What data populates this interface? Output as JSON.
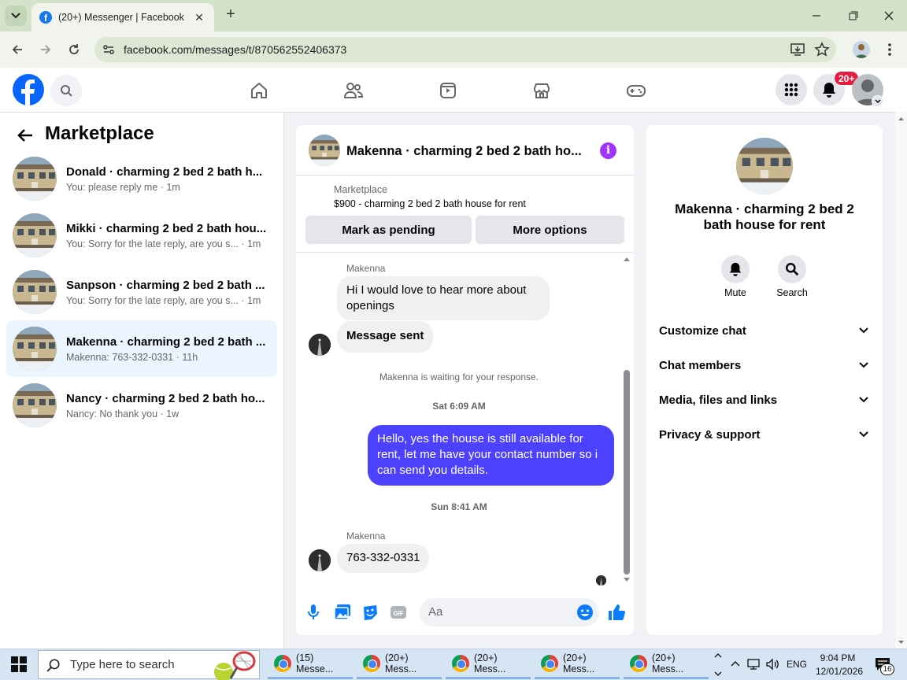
{
  "browser": {
    "tab_title": "(20+) Messenger | Facebook",
    "url": "facebook.com/messages/t/870562552406373",
    "new_tab": "+",
    "close_tab": "✕"
  },
  "fb": {
    "notif_badge": "20+"
  },
  "left": {
    "title": "Marketplace",
    "conversations": [
      {
        "name": "Donald · charming 2 bed 2 bath h...",
        "preview": "You: please reply me · 1m",
        "active": false
      },
      {
        "name": "Mikki · charming 2 bed 2 bath hou...",
        "preview": "You: Sorry for the late reply, are you s... · 1m",
        "active": false
      },
      {
        "name": "Sanpson · charming 2 bed 2 bath ...",
        "preview": "You: Sorry for the late reply, are you s... · 1m",
        "active": false
      },
      {
        "name": "Makenna · charming 2 bed 2 bath ...",
        "preview": "Makenna: 763-332-0331 · 11h",
        "active": true
      },
      {
        "name": "Nancy · charming 2 bed 2 bath ho...",
        "preview": "Nancy: No thank you · 1w",
        "active": false
      }
    ]
  },
  "chat": {
    "title": "Makenna · charming 2 bed 2 bath ho...",
    "marketplace_label": "Marketplace",
    "listing": "$900 - charming 2 bed 2 bath house for rent",
    "mark_pending": "Mark as pending",
    "more_options": "More options",
    "sender1": "Makenna",
    "msg1": "Hi I would love to hear more about openings",
    "msg2": "Message sent",
    "waiting": "Makenna is waiting for your response.",
    "ts1": "Sat 6:09 AM",
    "msg3": "Hello, yes the house is still available for rent, let me have your contact number so i can send you details.",
    "ts2": "Sun 8:41 AM",
    "sender2": "Makenna",
    "msg4": "763-332-0331",
    "composer_placeholder": "Aa"
  },
  "right": {
    "name": "Makenna · charming 2 bed 2 bath house for rent",
    "mute": "Mute",
    "search": "Search",
    "rows": [
      "Customize chat",
      "Chat members",
      "Media, files and links",
      "Privacy & support"
    ]
  },
  "taskbar": {
    "search_placeholder": "Type here to search",
    "apps": [
      "(15) Messe...",
      "(20+) Mess...",
      "(20+) Mess...",
      "(20+) Mess...",
      "(20+) Mess..."
    ],
    "lang": "ENG",
    "time": "9:04 PM",
    "date": "12/01/2026",
    "notif_count": "16"
  },
  "colors": {
    "fb_blue": "#0866ff",
    "my_bubble": "#4c41ff",
    "info": "#a033ff",
    "badge": "#e41e3f"
  }
}
